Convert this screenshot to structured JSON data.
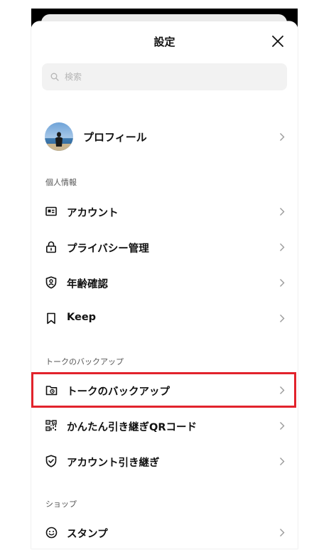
{
  "header": {
    "title": "設定",
    "close_icon": "close-icon"
  },
  "search": {
    "placeholder": "検索",
    "value": ""
  },
  "profile": {
    "label": "プロフィール",
    "avatar": "avatar"
  },
  "sections": [
    {
      "header": "個人情報",
      "items": [
        {
          "label": "アカウント",
          "icon": "id-card-icon"
        },
        {
          "label": "プライバシー管理",
          "icon": "lock-icon"
        },
        {
          "label": "年齢確認",
          "icon": "shield-person-icon"
        },
        {
          "label": "Keep",
          "icon": "bookmark-icon"
        }
      ]
    },
    {
      "header": "トークのバックアップ",
      "items": [
        {
          "label": "トークのバックアップ",
          "icon": "folder-backup-icon",
          "highlighted": true
        },
        {
          "label": "かんたん引き継ぎQRコード",
          "icon": "qr-code-icon"
        },
        {
          "label": "アカウント引き継ぎ",
          "icon": "shield-check-icon"
        }
      ]
    },
    {
      "header": "ショップ",
      "items": [
        {
          "label": "スタンプ",
          "icon": "smiley-icon"
        }
      ]
    }
  ],
  "colors": {
    "highlight": "#e2232c",
    "search_bg": "#f2f2f2",
    "text": "#111111",
    "chevron": "#9a9a9a"
  }
}
